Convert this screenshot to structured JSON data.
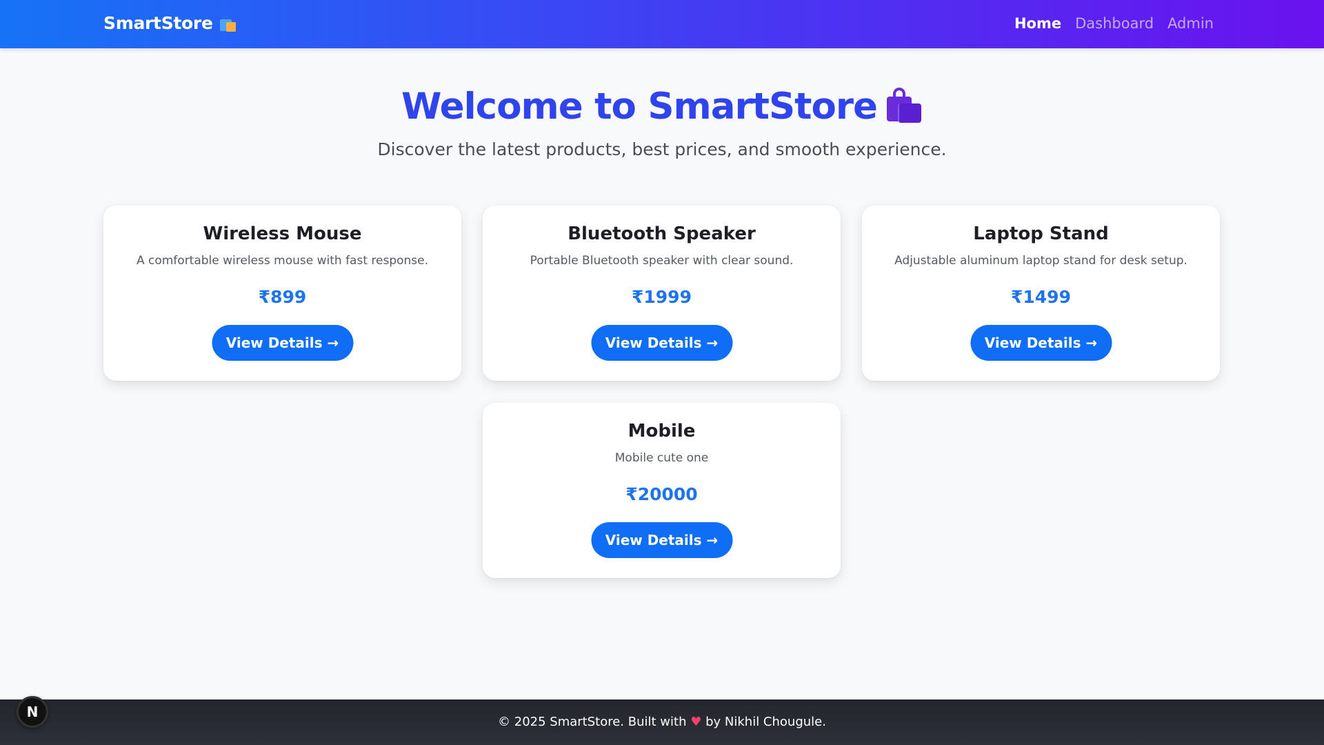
{
  "navbar": {
    "brand": "SmartStore",
    "brand_icon": "shopping-bags-icon",
    "links": [
      {
        "label": "Home",
        "active": true
      },
      {
        "label": "Dashboard",
        "active": false
      },
      {
        "label": "Admin",
        "active": false
      }
    ]
  },
  "hero": {
    "title": "Welcome to SmartStore",
    "title_icon": "shopping-bag-icon",
    "subtitle": "Discover the latest products, best prices, and smooth experience."
  },
  "products": [
    {
      "name": "Wireless Mouse",
      "description": "A comfortable wireless mouse with fast response.",
      "price": "₹899",
      "button": "View Details →"
    },
    {
      "name": "Bluetooth Speaker",
      "description": "Portable Bluetooth speaker with clear sound.",
      "price": "₹1999",
      "button": "View Details →"
    },
    {
      "name": "Laptop Stand",
      "description": "Adjustable aluminum laptop stand for desk setup.",
      "price": "₹1499",
      "button": "View Details →"
    },
    {
      "name": "Mobile",
      "description": "Mobile cute one",
      "price": "₹20000",
      "button": "View Details →"
    }
  ],
  "footer": {
    "text_before": "© 2025 SmartStore. Built with",
    "heart": "♥",
    "text_after": "by Nikhil Chougule."
  },
  "dev_badge": "N",
  "colors": {
    "accent": "#0f6ef5",
    "title": "#2f44ec",
    "nav_start": "#1673f7",
    "nav_end": "#6a12ef",
    "footer": "#2a2d34"
  }
}
